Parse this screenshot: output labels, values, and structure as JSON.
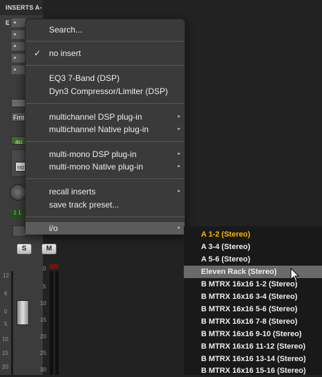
{
  "strip": {
    "header": "INSERTS A-E",
    "labels": {
      "frnt": "Frnt",
      "au": "au",
      "no": "no",
      "io": "1 1"
    },
    "solo": "S",
    "mute": "M",
    "fader_scale_left": [
      "12",
      "6",
      "0",
      "5",
      "10",
      "15",
      "20"
    ],
    "fader_scale_right": [
      "0",
      "5",
      "10",
      "15",
      "20",
      "25",
      "30"
    ]
  },
  "menu": {
    "search": "Search...",
    "no_insert": "no insert",
    "no_insert_checked": true,
    "eq3": "EQ3 7-Band (DSP)",
    "dyn3": "Dyn3 Compressor/Limiter (DSP)",
    "multichannel_dsp": "multichannel DSP plug-in",
    "multichannel_native": "multichannel Native plug-in",
    "multimono_dsp": "multi-mono DSP plug-in",
    "multimono_native": "multi-mono Native plug-in",
    "recall_inserts": "recall inserts",
    "save_track_preset": "save track preset...",
    "io": "i/o",
    "check_glyph": "✓",
    "arrow_glyph": "▸"
  },
  "submenu": {
    "items": [
      "A 1-2 (Stereo)",
      "A 3-4 (Stereo)",
      "A 5-6 (Stereo)",
      "Eleven Rack (Stereo)",
      "B MTRX 16x16 1-2 (Stereo)",
      "B MTRX 16x16 3-4 (Stereo)",
      "B MTRX 16x16 5-6 (Stereo)",
      "B MTRX 16x16 7-8 (Stereo)",
      "B MTRX 16x16 9-10 (Stereo)",
      "B MTRX 16x16 11-12 (Stereo)",
      "B MTRX 16x16 13-14 (Stereo)",
      "B MTRX 16x16 15-16 (Stereo)"
    ],
    "selected_index": 0,
    "hovered_index": 3
  },
  "colors": {
    "selected_text": "#f5b800",
    "menu_bg": "#3a3a3a",
    "submenu_bg": "#191919",
    "highlight": "#5b5b5b"
  }
}
